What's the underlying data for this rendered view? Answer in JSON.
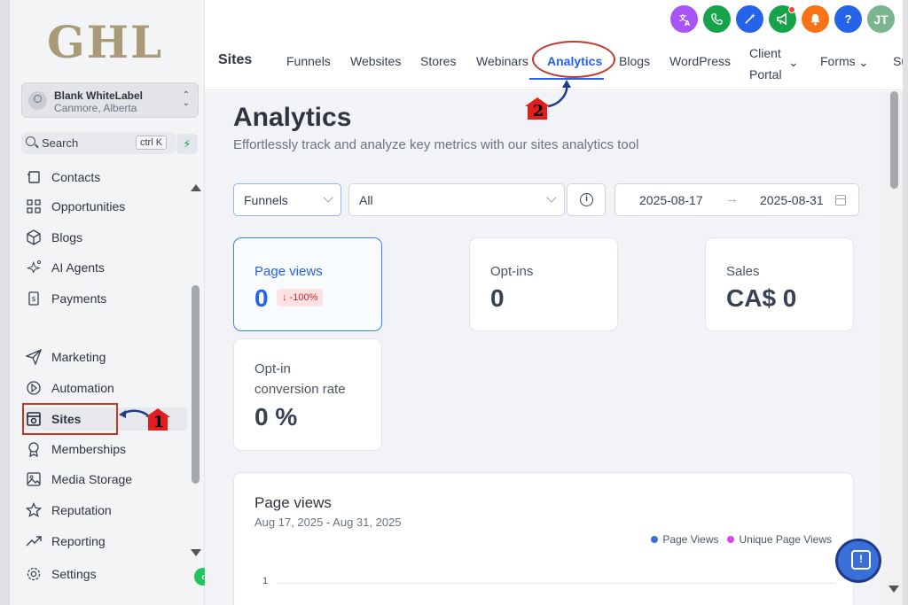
{
  "brand": {
    "logo_text": "GHL"
  },
  "account": {
    "name": "Blank WhiteLabel",
    "location": "Canmore, Alberta"
  },
  "search": {
    "label": "Search",
    "shortcut": "ctrl K"
  },
  "sidebar": {
    "items": [
      {
        "label": "Contacts",
        "icon": "contacts-icon"
      },
      {
        "label": "Opportunities",
        "icon": "opportunities-icon"
      },
      {
        "label": "Blogs",
        "icon": "blogs-icon"
      },
      {
        "label": "AI Agents",
        "icon": "sparkle-icon"
      },
      {
        "label": "Payments",
        "icon": "payments-icon"
      },
      {
        "label": "Marketing",
        "icon": "send-icon"
      },
      {
        "label": "Automation",
        "icon": "automation-icon"
      },
      {
        "label": "Sites",
        "icon": "sites-icon",
        "active": true
      },
      {
        "label": "Memberships",
        "icon": "award-icon"
      },
      {
        "label": "Media Storage",
        "icon": "image-icon"
      },
      {
        "label": "Reputation",
        "icon": "star-icon"
      },
      {
        "label": "Reporting",
        "icon": "trend-icon"
      },
      {
        "label": "Settings",
        "icon": "gear-icon"
      }
    ]
  },
  "header": {
    "section": "Sites",
    "tabs": [
      "Funnels",
      "Websites",
      "Stores",
      "Webinars",
      "Analytics",
      "Blogs",
      "WordPress",
      "Client Portal",
      "Forms",
      "Su"
    ],
    "client_portal_line1": "Client",
    "client_portal_line2": "Portal",
    "active_tab": "Analytics",
    "avatar_initials": "JT",
    "help_label": "?"
  },
  "main": {
    "title": "Analytics",
    "subtitle": "Effortlessly track and analyze key metrics with our sites analytics tool",
    "filter_type": "Funnels",
    "filter_scope": "All",
    "date_from": "2025-08-17",
    "date_to": "2025-08-31",
    "date_arrow": "→"
  },
  "metrics": {
    "page_views": {
      "label": "Page views",
      "value": "0",
      "change": "↓ -100%"
    },
    "optins": {
      "label": "Opt-ins",
      "value": "0"
    },
    "sales": {
      "label": "Sales",
      "value": "CA$ 0"
    },
    "conversion": {
      "label_line1": "Opt-in",
      "label_line2": "conversion rate",
      "value": "0 %"
    }
  },
  "chart_data": {
    "type": "line",
    "title": "Page views",
    "subtitle": "Aug 17, 2025 - Aug 31, 2025",
    "series": [
      {
        "name": "Page Views",
        "color": "#3b6fd8"
      },
      {
        "name": "Unique Page Views",
        "color": "#d946ef"
      }
    ],
    "y_ticks": [
      "1"
    ],
    "legend": "top-right"
  },
  "annotations": {
    "marker_1": "1",
    "marker_2": "2"
  },
  "colors": {
    "accent": "#2563eb",
    "annotation": "#c0392b",
    "active_green": "#22c55e"
  }
}
